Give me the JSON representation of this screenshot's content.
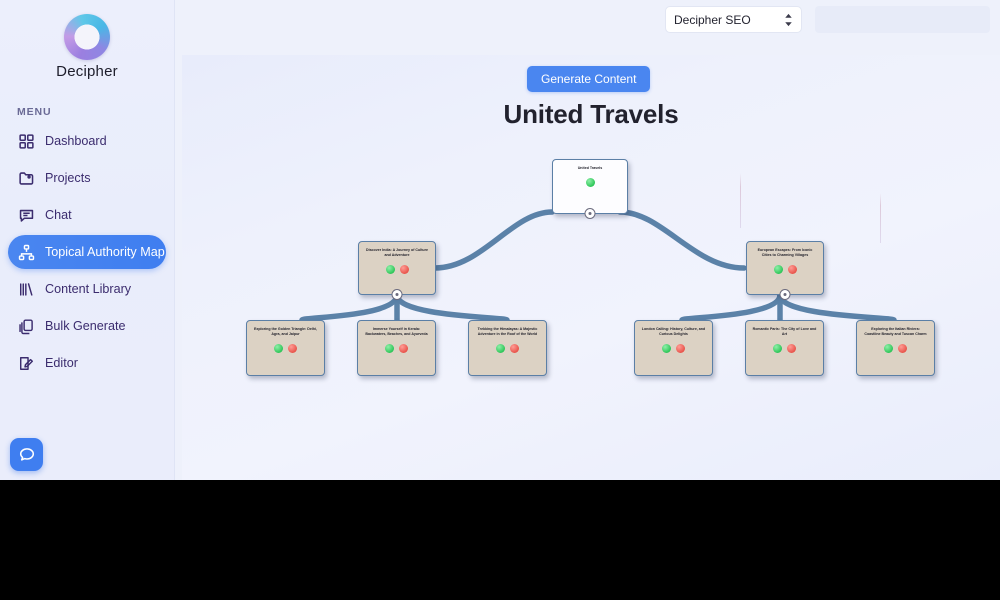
{
  "brand": {
    "name": "Decipher",
    "logo_icon": "decipher-ring-logo"
  },
  "sidebar": {
    "section_label": "MENU",
    "items": [
      {
        "label": "Dashboard",
        "icon": "grid-icon",
        "active": false
      },
      {
        "label": "Projects",
        "icon": "folder-icon",
        "active": false
      },
      {
        "label": "Chat",
        "icon": "chat-bubble-icon",
        "active": false
      },
      {
        "label": "Topical Authority Map",
        "icon": "sitemap-icon",
        "active": true
      },
      {
        "label": "Content Library",
        "icon": "library-bars-icon",
        "active": false
      },
      {
        "label": "Bulk Generate",
        "icon": "copy-stack-icon",
        "active": false
      },
      {
        "label": "Editor",
        "icon": "pencil-document-icon",
        "active": false
      }
    ]
  },
  "header": {
    "project_select": {
      "value": "Decipher SEO",
      "icon": "stepper-updown-icon"
    },
    "search": {
      "value": "",
      "placeholder": ""
    },
    "account_icon": "user-circle-icon"
  },
  "canvas": {
    "generate_button": "Generate Content",
    "title": "United Travels"
  },
  "chat_fab": {
    "icon": "chat-bubble-icon"
  },
  "colors": {
    "accent_blue": "#4a86f0",
    "node_tan": "#dcd2c4",
    "node_border": "#5b7fa6",
    "edge": "#5b82a8",
    "status_green": "#2fc659",
    "status_red": "#e8534a",
    "sidebar_text": "#3b2c6e"
  },
  "map": {
    "root": {
      "title": "United Travels",
      "status_dots": [
        "green"
      ]
    },
    "branches": [
      {
        "title": "Discover India: A Journey of Culture and Adventure",
        "status_dots": [
          "green",
          "red"
        ],
        "children": [
          {
            "title": "Exploring the Golden Triangle: Delhi, Agra, and Jaipur",
            "status_dots": [
              "green",
              "red"
            ]
          },
          {
            "title": "Immerse Yourself in Kerala: Backwaters, Beaches, and Ayurveda",
            "status_dots": [
              "green",
              "red"
            ]
          },
          {
            "title": "Trekking the Himalayas: A Majestic Adventure in the Roof of the World",
            "status_dots": [
              "green",
              "red"
            ]
          }
        ]
      },
      {
        "title": "European Escapes: From Iconic Cities to Charming Villages",
        "status_dots": [
          "green",
          "red"
        ],
        "children": [
          {
            "title": "London Calling: History, Culture, and Curious Delights",
            "status_dots": [
              "green",
              "red"
            ]
          },
          {
            "title": "Romantic Paris: The City of Love and Art",
            "status_dots": [
              "green",
              "red"
            ]
          },
          {
            "title": "Exploring the Italian Riviera: Coastline Beauty and Tuscan Charm",
            "status_dots": [
              "green",
              "red"
            ]
          }
        ]
      }
    ]
  }
}
